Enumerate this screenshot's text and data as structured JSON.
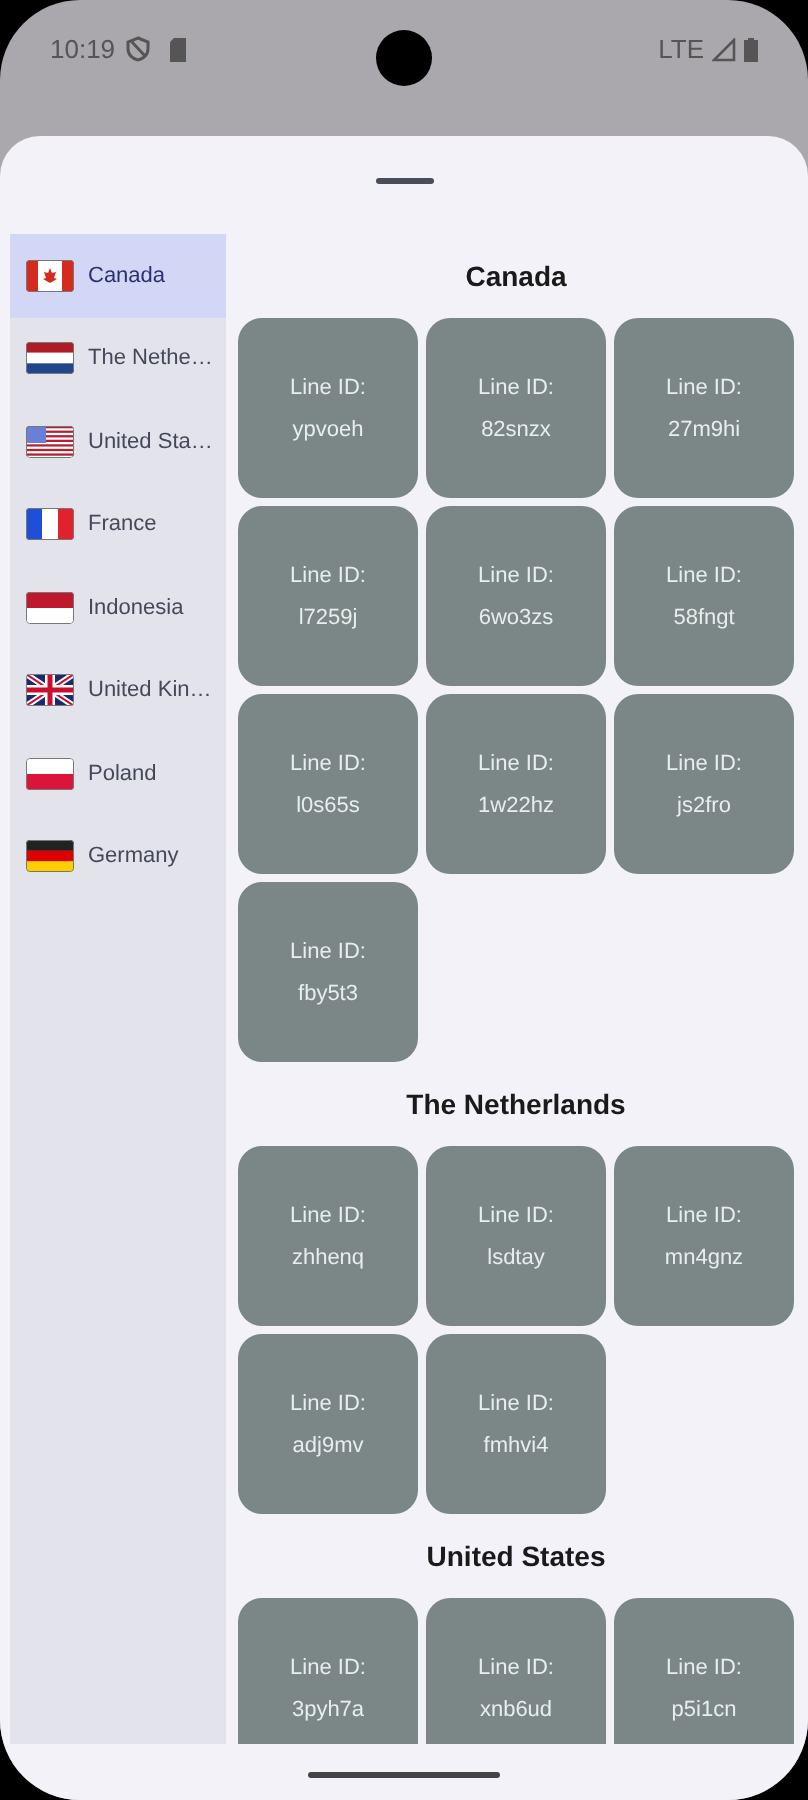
{
  "status_bar": {
    "time": "10:19",
    "network": "LTE"
  },
  "sidebar": {
    "items": [
      {
        "label": "Canada",
        "kind": "ca",
        "selected": true
      },
      {
        "label": "The Nethe…",
        "kind": "nl",
        "selected": false
      },
      {
        "label": "United Sta…",
        "kind": "us",
        "selected": false
      },
      {
        "label": "France",
        "kind": "fr",
        "selected": false
      },
      {
        "label": "Indonesia",
        "kind": "id",
        "selected": false
      },
      {
        "label": "United Kin…",
        "kind": "gb",
        "selected": false
      },
      {
        "label": "Poland",
        "kind": "pl",
        "selected": false
      },
      {
        "label": "Germany",
        "kind": "de",
        "selected": false
      }
    ]
  },
  "sections": [
    {
      "heading": "Canada",
      "lines": [
        {
          "label": "Line ID:",
          "id": "ypvoeh"
        },
        {
          "label": "Line ID:",
          "id": "82snzx"
        },
        {
          "label": "Line ID:",
          "id": "27m9hi"
        },
        {
          "label": "Line ID:",
          "id": "l7259j"
        },
        {
          "label": "Line ID:",
          "id": "6wo3zs"
        },
        {
          "label": "Line ID:",
          "id": "58fngt"
        },
        {
          "label": "Line ID:",
          "id": "l0s65s"
        },
        {
          "label": "Line ID:",
          "id": "1w22hz"
        },
        {
          "label": "Line ID:",
          "id": "js2fro"
        },
        {
          "label": "Line ID:",
          "id": "fby5t3"
        }
      ]
    },
    {
      "heading": "The Netherlands",
      "lines": [
        {
          "label": "Line ID:",
          "id": "zhhenq"
        },
        {
          "label": "Line ID:",
          "id": "lsdtay"
        },
        {
          "label": "Line ID:",
          "id": "mn4gnz"
        },
        {
          "label": "Line ID:",
          "id": "adj9mv"
        },
        {
          "label": "Line ID:",
          "id": "fmhvi4"
        }
      ]
    },
    {
      "heading": "United States",
      "lines": [
        {
          "label": "Line ID:",
          "id": "3pyh7a"
        },
        {
          "label": "Line ID:",
          "id": "xnb6ud"
        },
        {
          "label": "Line ID:",
          "id": "p5i1cn"
        }
      ]
    }
  ]
}
